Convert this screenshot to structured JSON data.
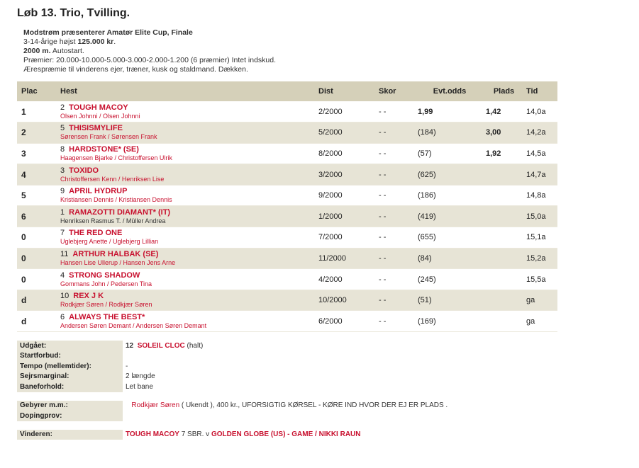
{
  "race": {
    "title": "Løb 13. Trio, Tvilling.",
    "sponsor": "Modstrøm præsenterer Amatør Elite Cup, Finale",
    "eligibility_prefix": "3-14-årige højst ",
    "eligibility_amount": "125.000 kr",
    "eligibility_suffix": ".",
    "distance": "2000 m.",
    "start_type": " Autostart.",
    "prizes": "Præmier: 20.000-10.000-5.000-3.000-2.000-1.200 (6 præmier) Intet indskud.",
    "honorary": "Ærespræmie til vinderens ejer, træner, kusk og staldmand. Dækken."
  },
  "table": {
    "headers": {
      "plac": "Plac",
      "hest": "Hest",
      "dist": "Dist",
      "skor": "Skor",
      "odds": "Evt.odds",
      "plads": "Plads",
      "tid": "Tid"
    },
    "rows": [
      {
        "plac": "1",
        "num": "2",
        "horse": "TOUGH MACOY",
        "drivers": "Olsen Johnni / Olsen Johnni",
        "drivers_dark": false,
        "dist": "2/2000",
        "skor": "- -",
        "odds": "1,99",
        "odds_bold": true,
        "plads": "1,42",
        "tid": "14,0a"
      },
      {
        "plac": "2",
        "num": "5",
        "horse": "THISISMYLIFE",
        "drivers": "Sørensen Frank / Sørensen Frank",
        "drivers_dark": false,
        "dist": "5/2000",
        "skor": "- -",
        "odds": "(184)",
        "odds_bold": false,
        "plads": "3,00",
        "tid": "14,2a"
      },
      {
        "plac": "3",
        "num": "8",
        "horse": "HARDSTONE* (SE)",
        "drivers": "Haagensen Bjarke / Christoffersen Ulrik",
        "drivers_dark": false,
        "dist": "8/2000",
        "skor": "- -",
        "odds": "(57)",
        "odds_bold": false,
        "plads": "1,92",
        "tid": "14,5a"
      },
      {
        "plac": "4",
        "num": "3",
        "horse": "TOXIDO",
        "drivers": "Christoffersen Kenn / Henriksen Lise",
        "drivers_dark": false,
        "dist": "3/2000",
        "skor": "- -",
        "odds": "(625)",
        "odds_bold": false,
        "plads": "",
        "tid": "14,7a"
      },
      {
        "plac": "5",
        "num": "9",
        "horse": "APRIL HYDRUP",
        "drivers": "Kristiansen Dennis / Kristiansen Dennis",
        "drivers_dark": false,
        "dist": "9/2000",
        "skor": "- -",
        "odds": "(186)",
        "odds_bold": false,
        "plads": "",
        "tid": "14,8a"
      },
      {
        "plac": "6",
        "num": "1",
        "horse": "RAMAZOTTI DIAMANT* (IT)",
        "drivers": "Henriksen Rasmus T. / Müller Andrea",
        "drivers_dark": true,
        "dist": "1/2000",
        "skor": "- -",
        "odds": "(419)",
        "odds_bold": false,
        "plads": "",
        "tid": "15,0a"
      },
      {
        "plac": "0",
        "num": "7",
        "horse": "THE RED ONE",
        "drivers": "Uglebjerg Anette / Uglebjerg Lillian",
        "drivers_dark": false,
        "dist": "7/2000",
        "skor": "- -",
        "odds": "(655)",
        "odds_bold": false,
        "plads": "",
        "tid": "15,1a"
      },
      {
        "plac": "0",
        "num": "11",
        "horse": "ARTHUR HALBAK (SE)",
        "drivers": "Hansen Lise Ullerup / Hansen Jens Arne",
        "drivers_dark": false,
        "dist": "11/2000",
        "skor": "- -",
        "odds": "(84)",
        "odds_bold": false,
        "plads": "",
        "tid": "15,2a"
      },
      {
        "plac": "0",
        "num": "4",
        "horse": "STRONG SHADOW",
        "drivers": "Gommans John / Pedersen Tina",
        "drivers_dark": false,
        "dist": "4/2000",
        "skor": "- -",
        "odds": "(245)",
        "odds_bold": false,
        "plads": "",
        "tid": "15,5a"
      },
      {
        "plac": "d",
        "num": "10",
        "horse": "REX J K",
        "drivers": "Rodkjær Søren / Rodkjær Søren",
        "drivers_dark": false,
        "dist": "10/2000",
        "skor": "- -",
        "odds": "(51)",
        "odds_bold": false,
        "plads": "",
        "tid": "ga"
      },
      {
        "plac": "d",
        "num": "6",
        "horse": "ALWAYS THE BEST*",
        "drivers": "Andersen Søren Demant / Andersen Søren Demant",
        "drivers_dark": false,
        "dist": "6/2000",
        "skor": "- -",
        "odds": "(169)",
        "odds_bold": false,
        "plads": "",
        "tid": "ga"
      }
    ]
  },
  "info": {
    "udgaet_label": "Udgået:",
    "udgaet_num": "12",
    "udgaet_horse": "SOLEIL CLOC",
    "udgaet_reason": " (halt)",
    "startforbud_label": "Startforbud:",
    "startforbud_value": "",
    "tempo_label": "Tempo (mellemtider):",
    "tempo_value": "-",
    "sejrsmargin_label": "Sejrsmarginal:",
    "sejrsmargin_value": "2 længde",
    "baneforhold_label": "Baneforhold:",
    "baneforhold_value": "Let bane",
    "gebyrer_label": "Gebyrer m.m.:",
    "gebyrer_name": "Rodkjær Søren",
    "gebyrer_text": " ( Ukendt ), 400 kr., UFORSIGTIG KØRSEL - KØRE IND HVOR DER EJ ER PLADS .",
    "doping_label": "Dopingprov:",
    "doping_value": "",
    "vinderen_label": "Vinderen:",
    "vinderen_horse": "TOUGH MACOY",
    "vinderen_mid": " 7 SBR. v ",
    "vinderen_sire": "GOLDEN GLOBE (US) - GAME / NIKKI RAUN"
  }
}
